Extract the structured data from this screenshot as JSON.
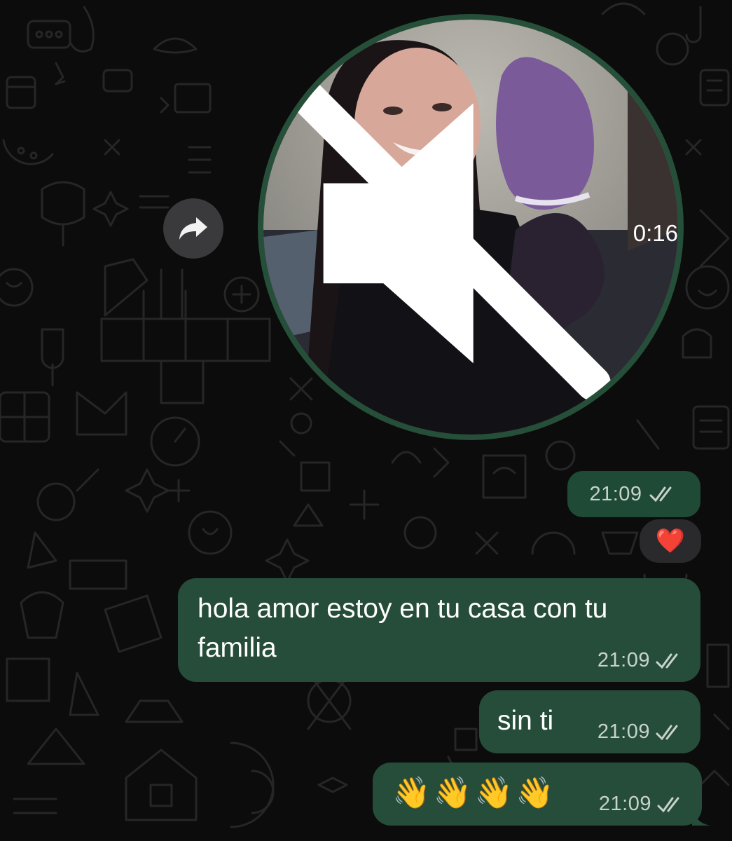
{
  "video": {
    "duration": "0:16",
    "muted": true,
    "frame_description_icon": "video-frame"
  },
  "video_time": {
    "time": "21:09",
    "status_icon": "read-double-check-icon"
  },
  "reaction": {
    "emoji": "❤️"
  },
  "messages": [
    {
      "text": "hola amor estoy en tu casa con tu\nfamilia",
      "time": "21:09"
    },
    {
      "text": "sin ti",
      "time": "21:09"
    },
    {
      "text": "👋👋👋👋",
      "time": "21:09"
    }
  ],
  "colors": {
    "background": "#0c0c0c",
    "outgoing_bubble": "#264d39",
    "video_ring": "#264f39",
    "forward_button": "#3a3a3c"
  }
}
